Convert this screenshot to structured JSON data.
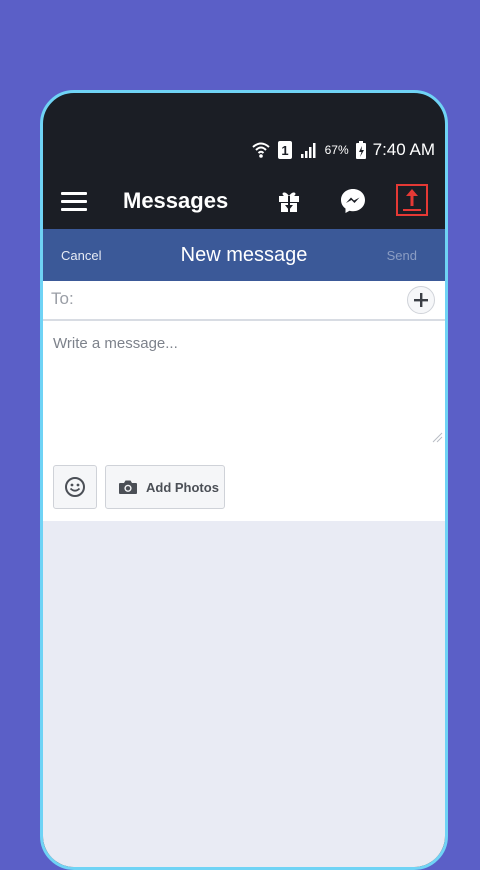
{
  "status": {
    "signal_badge": "1",
    "battery": "67%",
    "time": "7:40 AM"
  },
  "appbar": {
    "title": "Messages",
    "icons": [
      "menu-icon",
      "gift-icon",
      "messenger-icon",
      "upload-icon"
    ]
  },
  "compose": {
    "cancel_label": "Cancel",
    "title": "New message",
    "send_label": "Send"
  },
  "recipient": {
    "label": "To:",
    "value": ""
  },
  "message": {
    "placeholder": "Write a message...",
    "value": ""
  },
  "actions": {
    "add_photos_label": "Add Photos"
  },
  "colors": {
    "background": "#5b5fc7",
    "phone_frame": "#6fd3f5",
    "appbar": "#1b1e25",
    "compose_header": "#3b5998",
    "upload_accent": "#e53935"
  }
}
